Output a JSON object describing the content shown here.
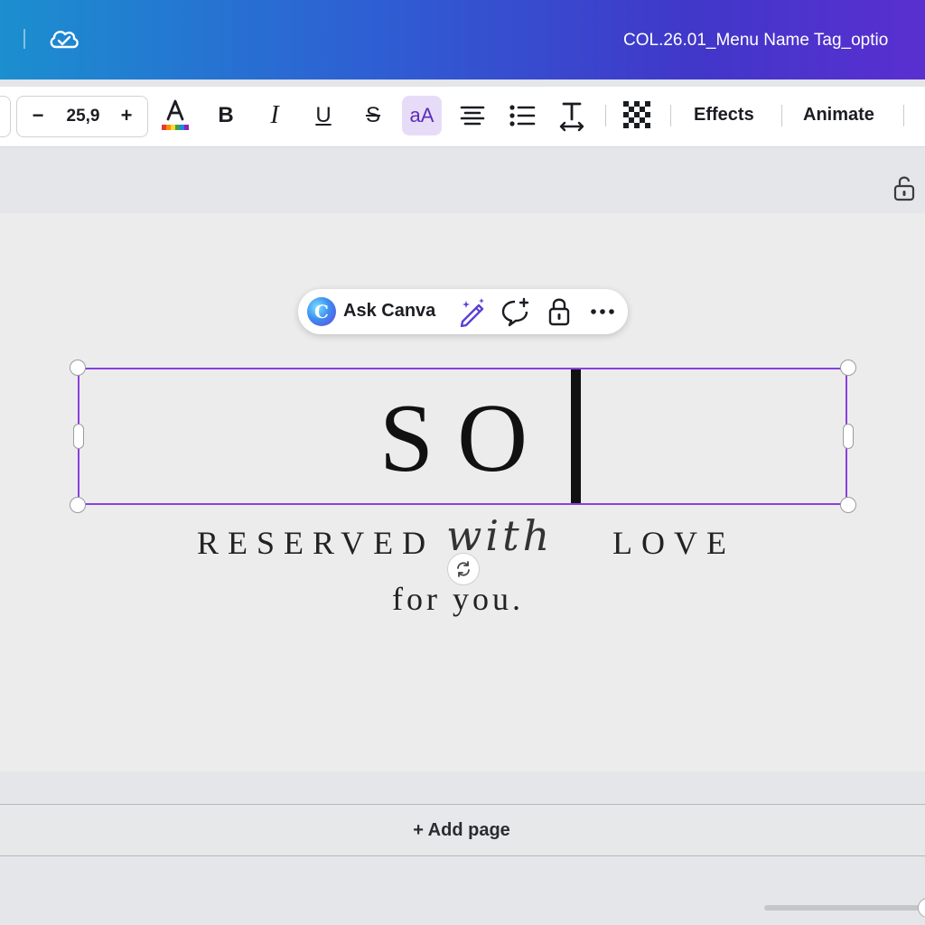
{
  "header": {
    "document_title": "COL.26.01_Menu Name Tag_optio",
    "cloud_icon": "cloud-check-icon"
  },
  "toolbar": {
    "font_size": "25,9",
    "minus_label": "−",
    "plus_label": "+",
    "bold_label": "B",
    "italic_label": "I",
    "underline_label": "U",
    "strike_label": "S",
    "case_label": "aA",
    "effects_label": "Effects",
    "animate_label": "Animate",
    "accent_color": "#8b3fe0"
  },
  "context_menu": {
    "ask_label": "Ask Canva",
    "logo_letter": "C"
  },
  "canvas": {
    "selected_text": "SO",
    "line1_left": "RESERVED",
    "line1_script": "with",
    "line1_right": "LOVE",
    "line2": "for you."
  },
  "footer": {
    "add_page_label": "+ Add page"
  }
}
